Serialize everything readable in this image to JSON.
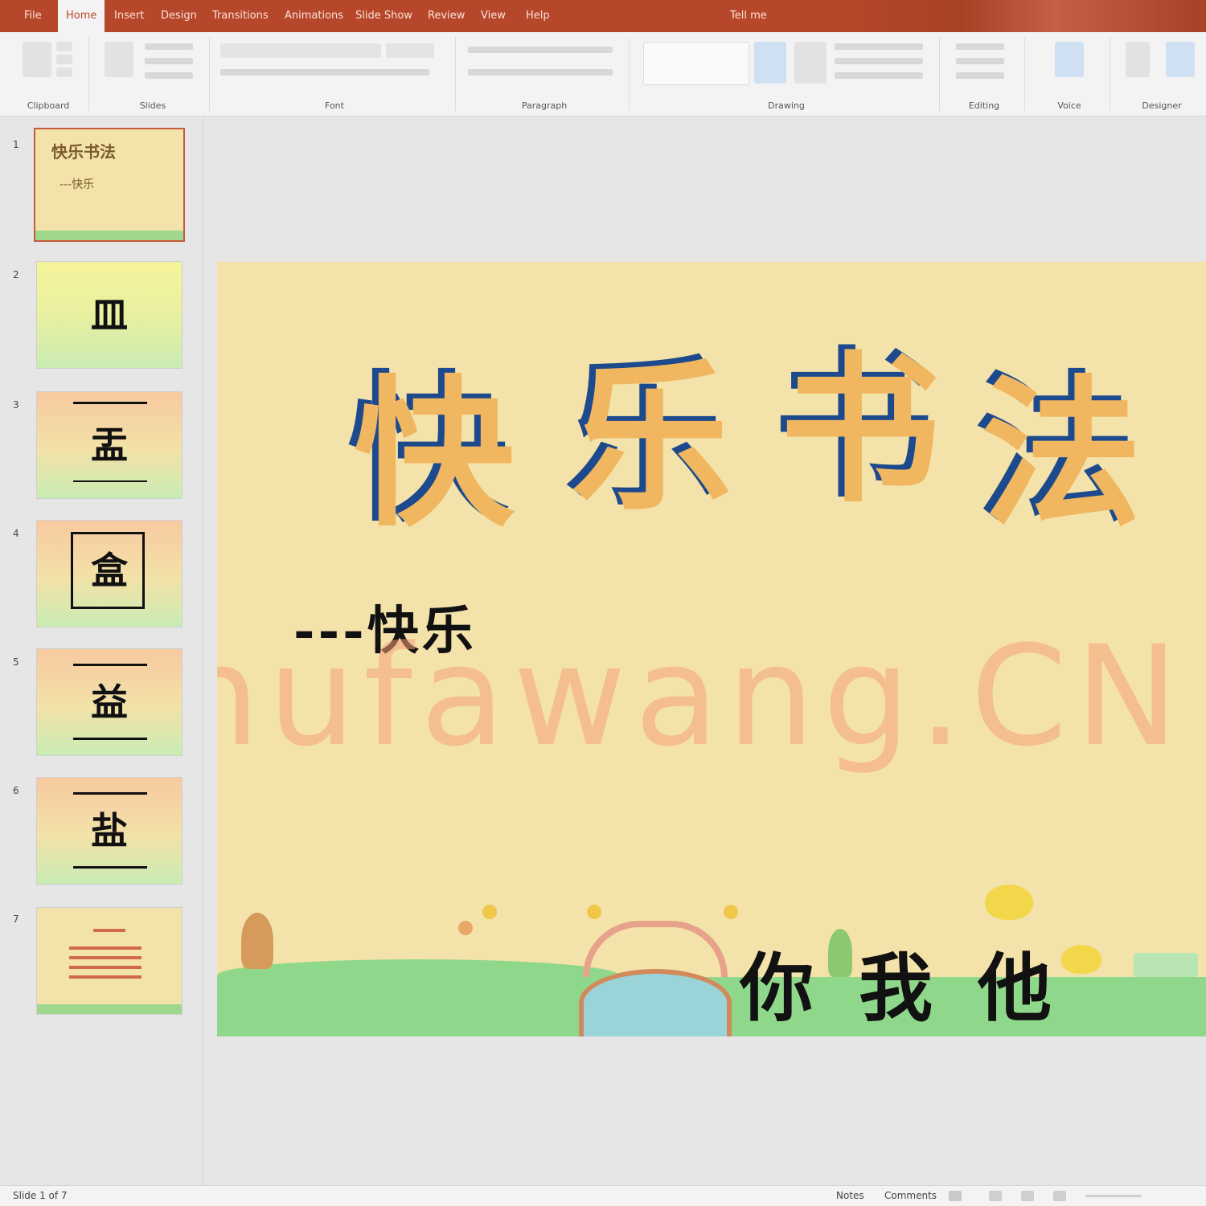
{
  "ribbon": {
    "tabs": [
      "File",
      "Home",
      "Insert",
      "Design",
      "Transitions",
      "Animations",
      "Slide Show",
      "Review",
      "View",
      "Help",
      "Tell me"
    ],
    "active_tab": "Home",
    "groups": [
      "Clipboard",
      "Slides",
      "Font",
      "Paragraph",
      "Drawing",
      "Editing",
      "Voice",
      "Designer"
    ]
  },
  "slides": [
    {
      "number": "1",
      "title": "快乐书法",
      "subtitle": "---快乐"
    },
    {
      "number": "2",
      "char": "皿"
    },
    {
      "number": "3",
      "char": "盂"
    },
    {
      "number": "4",
      "char": "盒"
    },
    {
      "number": "5",
      "char": "益"
    },
    {
      "number": "6",
      "char": "盐"
    },
    {
      "number": "7"
    }
  ],
  "slide": {
    "title_chars": [
      "快",
      "乐",
      "书",
      "法"
    ],
    "subtitle": "---快乐",
    "names": "你我他",
    "watermark": "Shufawang.CN"
  },
  "status": {
    "slide_info": "Slide 1 of 7",
    "notes": "Notes",
    "comments": "Comments"
  },
  "colors": {
    "accent": "#b7472a",
    "slide_bg": "#f3e3aa",
    "title_fill": "#f0b760",
    "title_shadow": "#1d4a8c",
    "watermark": "#f6a078"
  }
}
